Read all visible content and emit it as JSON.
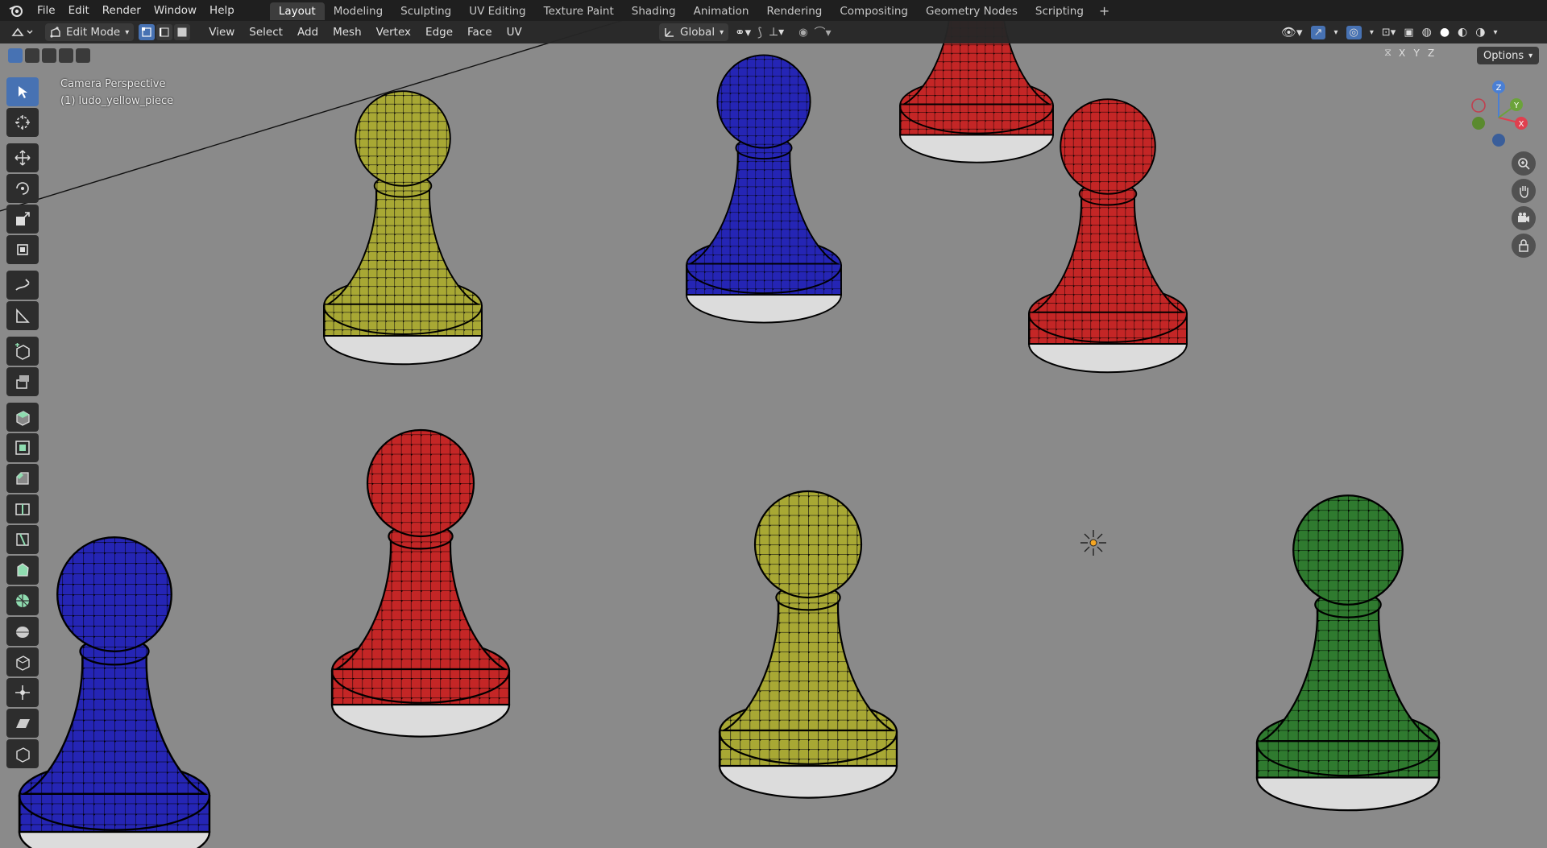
{
  "menu": [
    "File",
    "Edit",
    "Render",
    "Window",
    "Help"
  ],
  "workspaces": [
    "Layout",
    "Modeling",
    "Sculpting",
    "UV Editing",
    "Texture Paint",
    "Shading",
    "Animation",
    "Rendering",
    "Compositing",
    "Geometry Nodes",
    "Scripting"
  ],
  "active_workspace": "Layout",
  "header": {
    "mode": "Edit Mode",
    "menus": [
      "View",
      "Select",
      "Add",
      "Mesh",
      "Vertex",
      "Edge",
      "Face",
      "UV"
    ],
    "transform_orientation": "Global"
  },
  "axes": {
    "x": "X",
    "y": "Y",
    "z": "Z"
  },
  "options_label": "Options",
  "viewport": {
    "perspective_label": "Camera Perspective",
    "object_label": "(1) ludo_yellow_piece"
  },
  "gizmo": {
    "x": "X",
    "y": "Y",
    "z": "Z"
  },
  "colors": {
    "yellow_piece": "#a8a834",
    "blue_piece": "#2525b5",
    "red_piece": "#c42626",
    "green_piece": "#2f7a2f",
    "accent": "#4772b3",
    "viewport_bg": "#8a8a8a"
  },
  "pieces": [
    {
      "color": "yellow",
      "name": "yellow-piece"
    },
    {
      "color": "blue",
      "name": "blue-piece"
    },
    {
      "color": "red",
      "name": "red-piece"
    },
    {
      "color": "red",
      "name": "red-piece"
    },
    {
      "color": "yellow",
      "name": "yellow-piece"
    },
    {
      "color": "green",
      "name": "green-piece"
    },
    {
      "color": "blue",
      "name": "blue-piece"
    },
    {
      "color": "red",
      "name": "red-piece"
    }
  ]
}
